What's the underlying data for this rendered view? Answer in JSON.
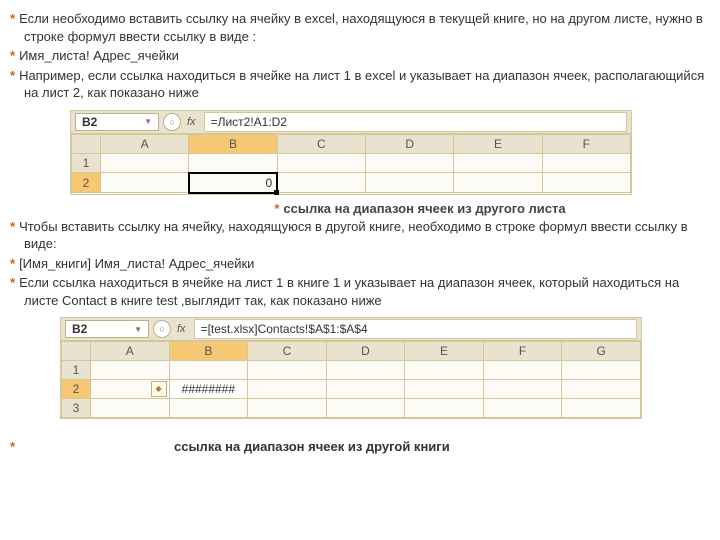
{
  "para1": "Если необходимо вставить ссылку на ячейку в excel, находящуюся в текущей книге, но на другом листе, нужно в строке формул ввести ссылку в виде :",
  "para2": "Имя_листа! Адрес_ячейки",
  "para3": "Например, если ссылка находиться в ячейке на  лист 1 в excel и указывает на диапазон ячеек, располагающийся  на лист 2, как показано ниже",
  "excel1": {
    "cellref": "B2",
    "fx": "fx",
    "formula": "=Лист2!A1:D2",
    "cols": [
      "A",
      "B",
      "C",
      "D",
      "E",
      "F"
    ],
    "rows": [
      "1",
      "2"
    ],
    "b2value": "0"
  },
  "caption1": "ссылка на диапазон ячеек из другого листа",
  "para4": "Чтобы вставить ссылку на ячейку, находящуюся в другой книге, необходимо в строке формул ввести ссылку в виде:",
  "para5": "[Имя_книги] Имя_листа! Адрес_ячейки",
  "para6": "Если ссылка находиться в ячейке на лист 1 в книге 1 и указывает на диапазон ячеек, который находиться на листе Contact в книге test ,выглядит так, как показано ниже",
  "excel2": {
    "cellref": "B2",
    "fx": "fx",
    "formula": "=[test.xlsx]Contacts!$A$1:$A$4",
    "cols": [
      "A",
      "B",
      "C",
      "D",
      "E",
      "F",
      "G"
    ],
    "rows": [
      "1",
      "2",
      "3"
    ],
    "b2value": "########"
  },
  "caption2": "ссылка на диапазон ячеек из другой книги"
}
